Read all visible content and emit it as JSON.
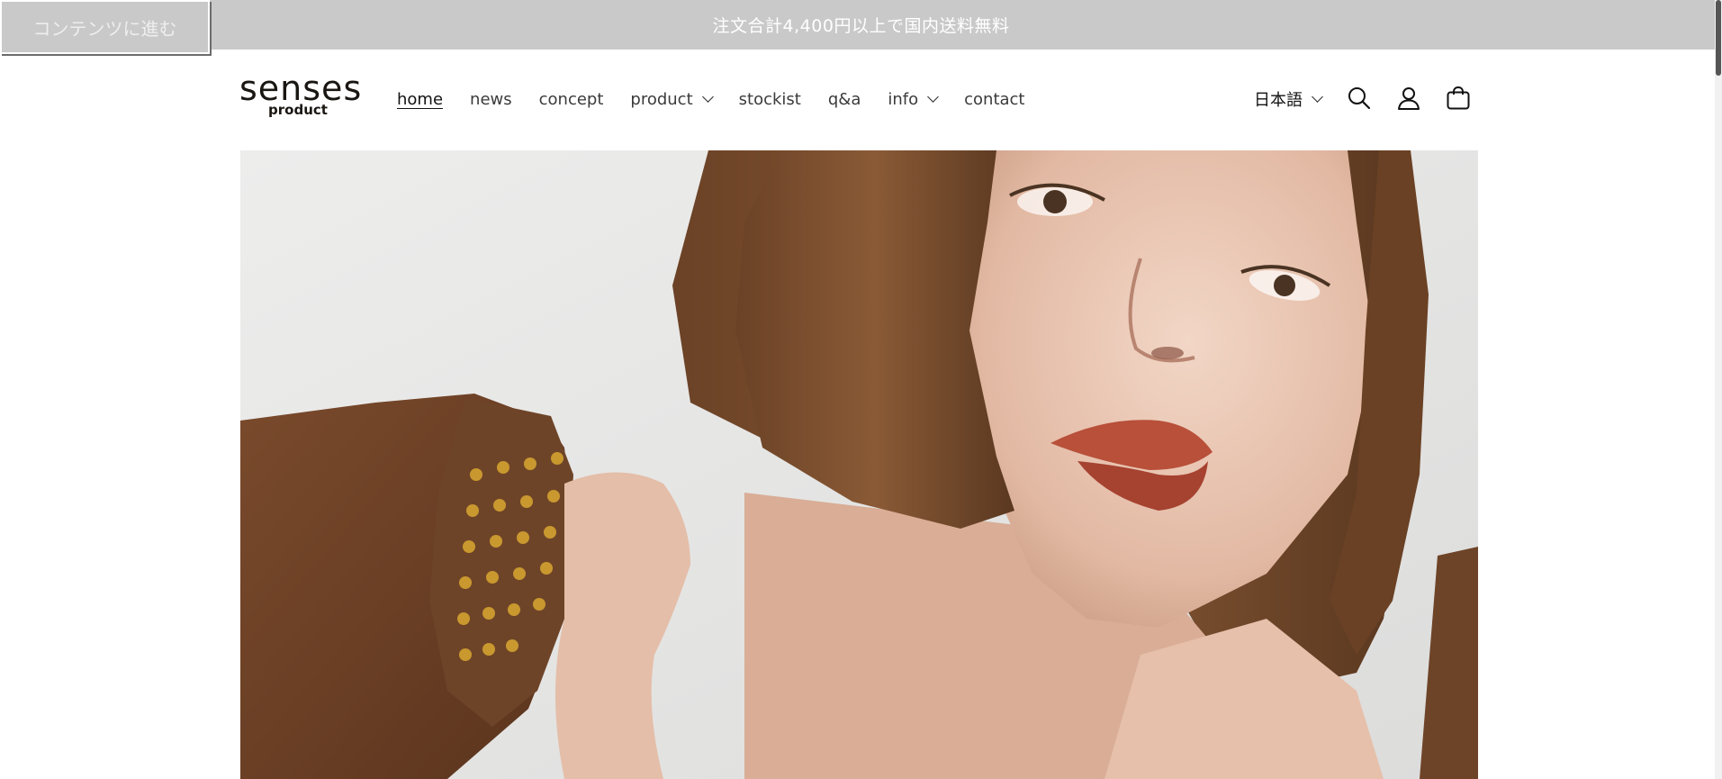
{
  "announcement": {
    "text": "注文合計4,400円以上で国内送料無料"
  },
  "skip_link": {
    "label": "コンテンツに進む"
  },
  "logo": {
    "main": "senses",
    "sub": "product"
  },
  "nav": {
    "items": [
      {
        "label": "home",
        "active": true,
        "dropdown": false
      },
      {
        "label": "news",
        "active": false,
        "dropdown": false
      },
      {
        "label": "concept",
        "active": false,
        "dropdown": false
      },
      {
        "label": "product",
        "active": false,
        "dropdown": true
      },
      {
        "label": "stockist",
        "active": false,
        "dropdown": false
      },
      {
        "label": "q&a",
        "active": false,
        "dropdown": false
      },
      {
        "label": "info",
        "active": false,
        "dropdown": true
      },
      {
        "label": "contact",
        "active": false,
        "dropdown": false
      }
    ]
  },
  "header_actions": {
    "language": "日本語",
    "icons": [
      "search-icon",
      "account-icon",
      "cart-icon"
    ]
  },
  "colors": {
    "announcement_bg": "#c8c9c8",
    "text": "#121212",
    "hero_bg": "#e9e9e8"
  }
}
